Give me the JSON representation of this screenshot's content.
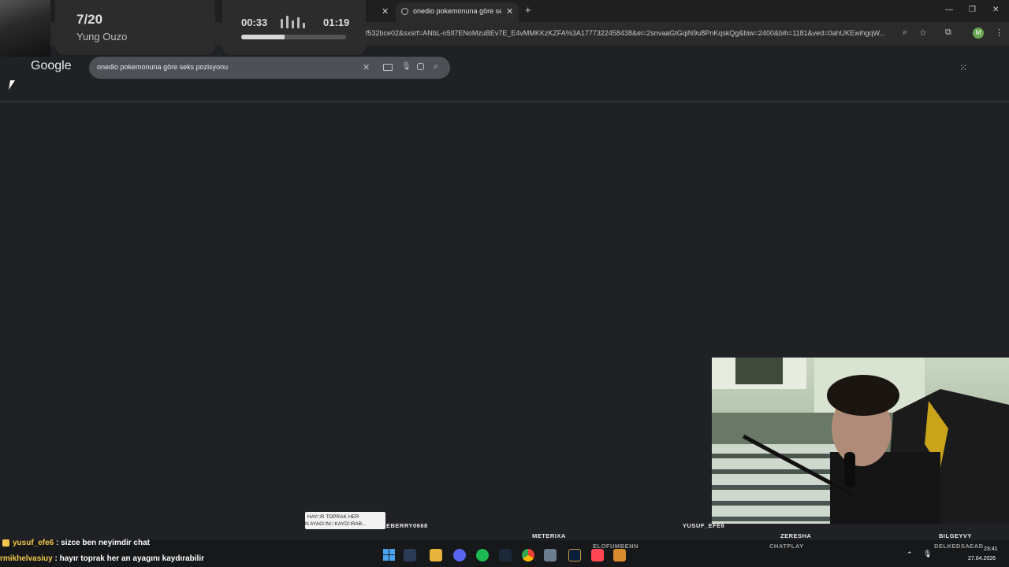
{
  "browser": {
    "active_tab_title": "onedio pokemonuna göre seks",
    "url": "f532bce02&sxsrf=ANbL-n5fl7ENoMzuBEv7E_E4vMMKKzKZFA%3A1777322458438&ei=2snvaaGtGqiN9u8PnKqskQg&biw=2400&bih=1181&ved=0ahUKEwihgqW...",
    "profile_initial": "M",
    "new_tab_symbol": "+",
    "close_symbol": "✕"
  },
  "google": {
    "logo": "Google",
    "query": "onedio pokemonuna göre seks pozisyonu"
  },
  "music": {
    "track": "7/20",
    "artist": "Yung Ouzo",
    "elapsed": "00:33",
    "total": "01:19",
    "progress": 0.41
  },
  "stream": {
    "alert_line1": "HAY□R TOPRAK HER",
    "alert_line2": "N AYAG□N□ KAYD□RAB...",
    "viewer_names": {
      "a": "EBERRY0668",
      "b": "YUSUF_EFE6",
      "c": "METERIXA",
      "d": "ZERESHA",
      "e": "BILGEYVY",
      "f": "ELOFUMBENN",
      "g": "CHATPLAY",
      "h": "DELKEDSAEAD"
    },
    "chat": [
      {
        "user": "yusuf_efe6",
        "message": " : sizce ben neyimdir chat"
      },
      {
        "user": "rmikhelvasiuy",
        "message": " : hayır toprak her an ayagını kaydırabilir"
      }
    ]
  },
  "taskbar": {
    "time": "23:41",
    "date": "27.04.2026"
  },
  "colors": {
    "background": "#202124",
    "chat_username": "#f3c64d",
    "spotify": "#1db954",
    "chrome_red": "#ea4335"
  }
}
